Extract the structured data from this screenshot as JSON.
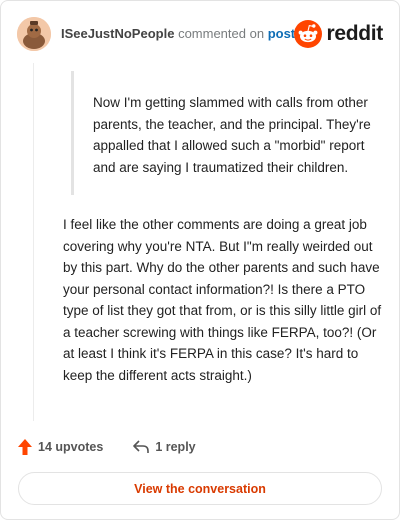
{
  "header": {
    "username": "ISeeJustNoPeople",
    "action_text": "commented on",
    "post_link": "post",
    "brand_name": "reddit",
    "brand_color": "#ff4500"
  },
  "quote": {
    "text": "Now I'm getting slammed with calls from other parents, the teacher, and the principal. They're appalled that I allowed such a \"morbid\" report and are saying I traumatized their children."
  },
  "comment": {
    "text": "I feel like the other comments are doing a great job covering why you're NTA. But I\"m really weirded out by this part. Why do the other parents and such have your personal contact information?! Is there a PTO type of list they got that from, or is this silly little girl of a teacher screwing with things like FERPA, too?! (Or at least I think it's FERPA in this case? It's hard to keep the different acts straight.)"
  },
  "actions": {
    "upvotes_label": "14 upvotes",
    "reply_label": "1 reply",
    "upvote_color": "#ff4500"
  },
  "footer": {
    "view_label": "View the conversation",
    "view_color": "#d93a00"
  },
  "icons": {
    "avatar": "user-avatar-icon",
    "brand": "reddit-logo-icon",
    "upvote": "upvote-arrow-icon",
    "reply": "reply-arrow-icon"
  }
}
